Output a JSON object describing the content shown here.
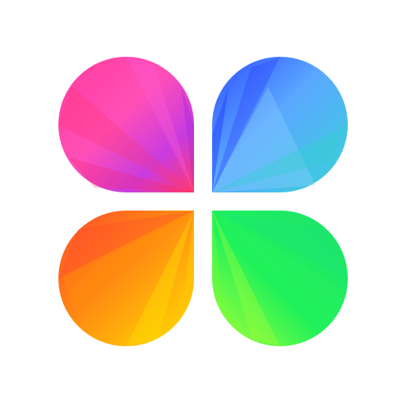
{
  "app_icon": {
    "name": "four-petal-launcher-logo",
    "background_color": "#ffffff",
    "petals": [
      {
        "id": "top-left",
        "colors": [
          "#ff4fb7",
          "#b63ad8",
          "#ff3a6e"
        ]
      },
      {
        "id": "top-right",
        "colors": [
          "#2f4dff",
          "#4cc9f0",
          "#7fd7ff"
        ]
      },
      {
        "id": "bottom-left",
        "colors": [
          "#ff5b2e",
          "#ff9a12",
          "#ffe000"
        ]
      },
      {
        "id": "bottom-right",
        "colors": [
          "#1fdc72",
          "#25f25a",
          "#a6ff3a"
        ]
      }
    ]
  }
}
